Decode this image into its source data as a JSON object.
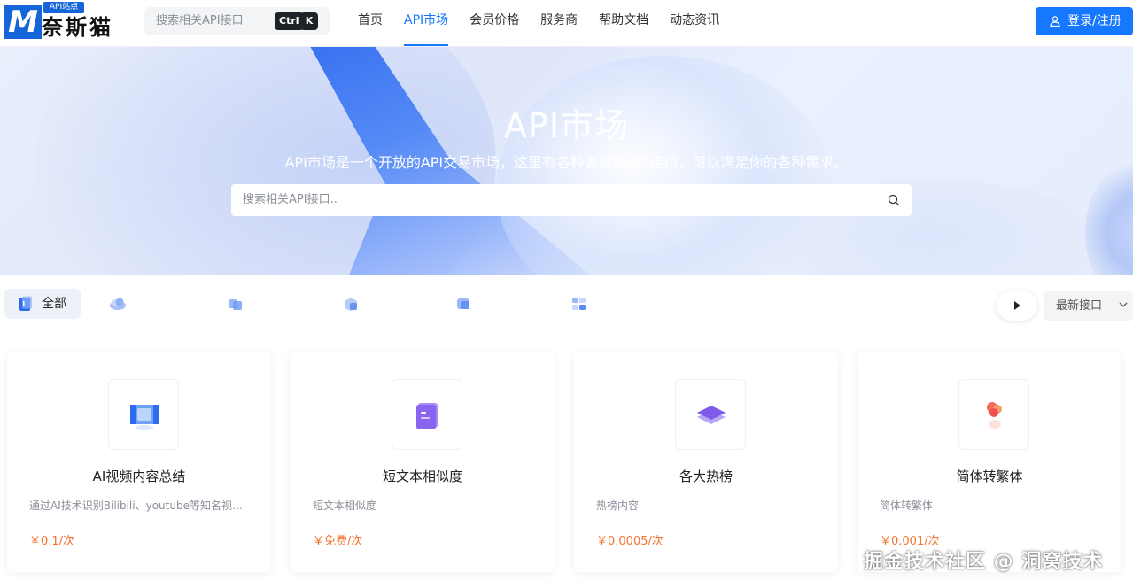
{
  "header": {
    "logo_tag": "API站点",
    "logo_name": "奈斯猫",
    "logo_letter": "M",
    "search_placeholder": "搜索相关API接口",
    "shortcut_ctrl": "Ctrl",
    "shortcut_k": "K",
    "nav": [
      {
        "label": "首页",
        "active": false
      },
      {
        "label": "API市场",
        "active": true
      },
      {
        "label": "会员价格",
        "active": false
      },
      {
        "label": "服务商",
        "active": false
      },
      {
        "label": "帮助文档",
        "active": false
      },
      {
        "label": "动态资讯",
        "active": false
      }
    ],
    "login_label": "登录/注册"
  },
  "hero": {
    "title": "API市场",
    "subtitle": "API市场是一个开放的API交易市场，这里有各种各样的API接口，可以满足你的各种需求。",
    "search_placeholder": "搜索相关API接口.."
  },
  "categories": {
    "all_label": "全部",
    "icons": [
      "cloud-icon",
      "cube-icon",
      "package-icon",
      "box-icon",
      "grid-icon"
    ]
  },
  "sort": {
    "selected": "最新接口"
  },
  "cards": [
    {
      "title": "AI视频内容总结",
      "desc": "通过AI技术识别Bilibili、youtube等知名视频平台的视频内容并进行总结",
      "price": "￥0.1/次",
      "icon": "video-icon"
    },
    {
      "title": "短文本相似度",
      "desc": "短文本相似度",
      "price": "￥免费/次",
      "icon": "document-icon"
    },
    {
      "title": "各大热榜",
      "desc": "热榜内容",
      "price": "￥0.0005/次",
      "icon": "layers-icon"
    },
    {
      "title": "简体转繁体",
      "desc": "简体转繁体",
      "price": "￥0.001/次",
      "icon": "translate-icon"
    }
  ],
  "watermark": "掘金技术社区 @ 洞窝技术",
  "colors": {
    "accent": "#1677ff",
    "price": "#f5732f",
    "logo": "#1565d8"
  }
}
